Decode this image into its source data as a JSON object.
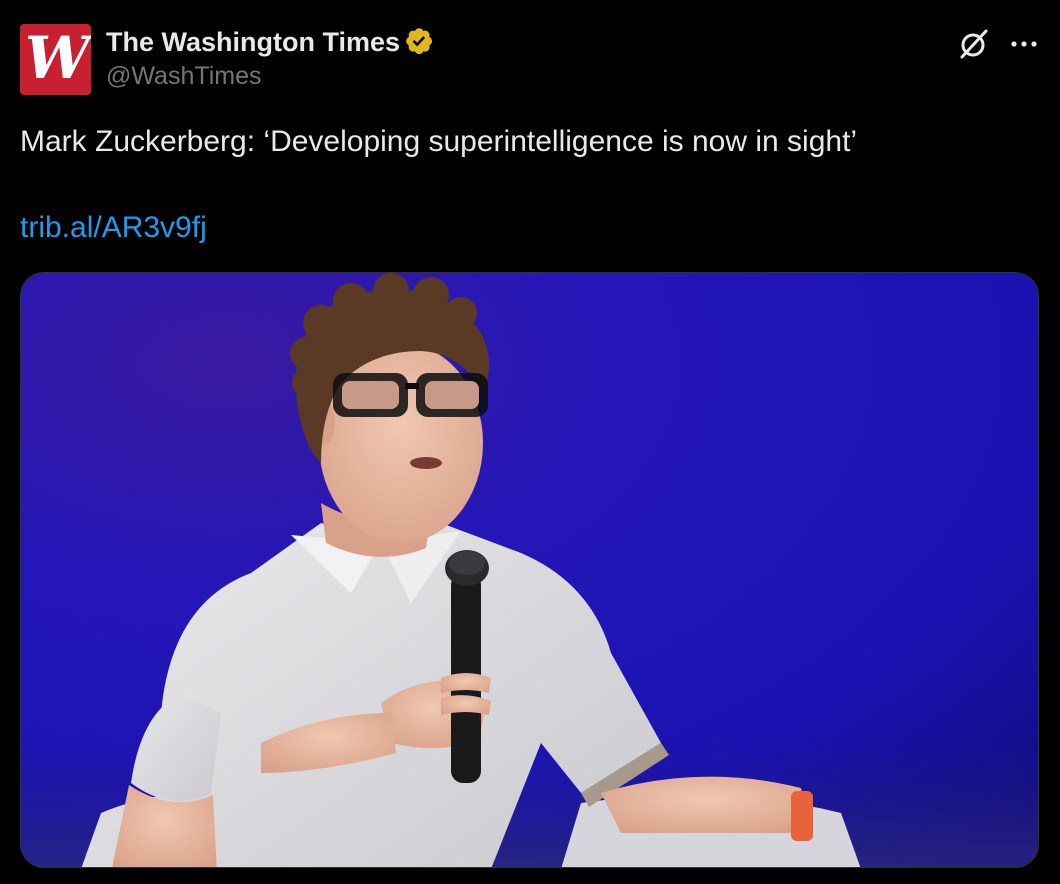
{
  "account": {
    "display_name": "The Washington Times",
    "handle": "@WashTimes",
    "avatar_icon": "washington-times-logo",
    "verified_badge_icon": "verified-gold-badge-icon",
    "verified_color": "#e2b719"
  },
  "actions": {
    "grok_icon": "grok-icon",
    "more_icon": "more-options-icon"
  },
  "tweet": {
    "text": "Mark Zuckerberg: ‘Developing superintelligence is now in sight’",
    "link": "trib.al/AR3v9fj",
    "link_color": "#1d9bf0"
  },
  "media": {
    "type": "photo",
    "subject": "man-with-microphone-photo",
    "background_color": "#1a10a8"
  }
}
